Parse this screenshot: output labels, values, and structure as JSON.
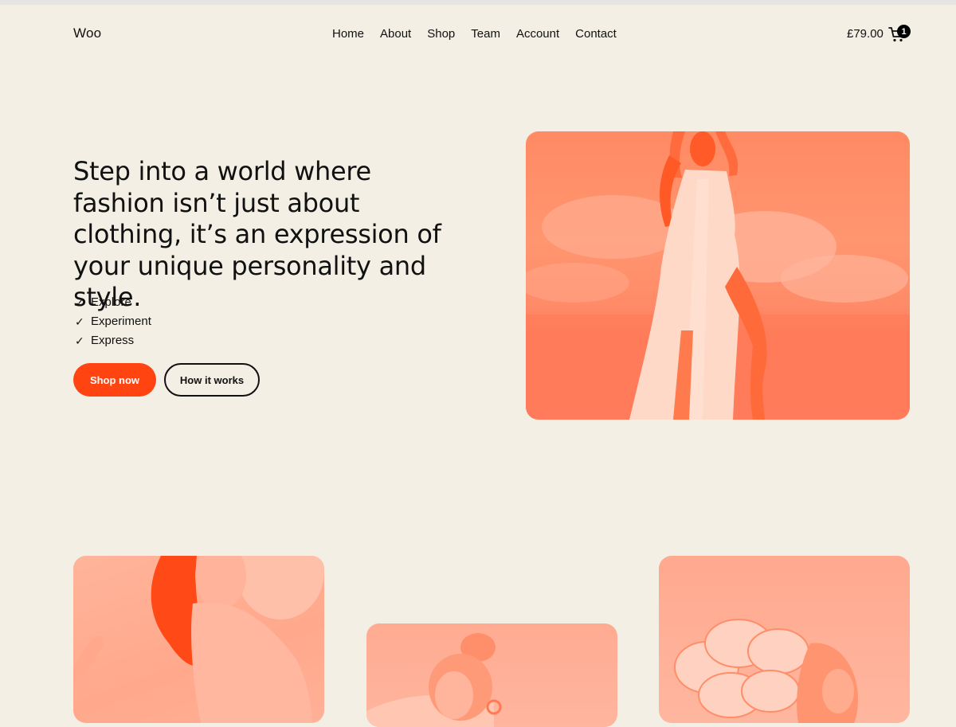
{
  "header": {
    "brand": "Woo",
    "nav": [
      "Home",
      "About",
      "Shop",
      "Team",
      "Account",
      "Contact"
    ],
    "cart_total": "£79.00",
    "cart_count": "1"
  },
  "hero": {
    "title": "Step into a world where fashion isn’t just about clothing, it’s an expression of your unique personality and style.",
    "checklist": [
      "Explore",
      "Experiment",
      "Express"
    ],
    "check_glyph": "✓",
    "primary_button": "Shop now",
    "secondary_button": "How it works"
  },
  "icons": {
    "cart": "cart-icon",
    "check": "check-icon"
  },
  "colors": {
    "background": "#f3efe4",
    "accent": "#ff4412",
    "photo_tint": "#ff8a63",
    "text": "#111111"
  }
}
